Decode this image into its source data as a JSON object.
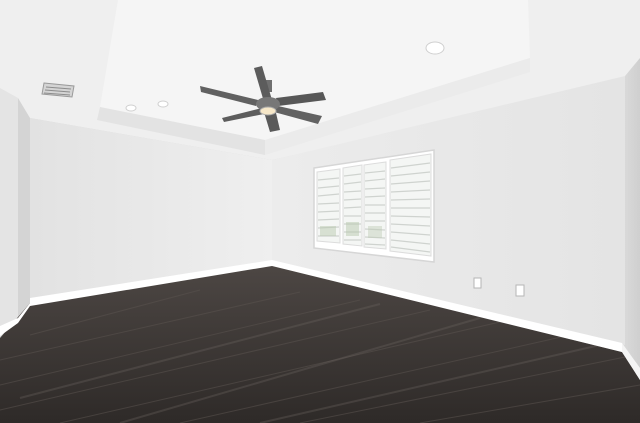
{
  "scene": {
    "description_free": true,
    "colors": {
      "ceiling": "#f1f1f1",
      "tray_ceiling": "#f6f6f6",
      "wall_left": "#e9e9e9",
      "wall_back_left": "#eeeeee",
      "wall_back_right": "#e7e7e7",
      "wall_right": "#dcdcdc",
      "floor_dark": "#2f2b29",
      "floor_mid": "#4a4542",
      "baseboard": "#ffffff",
      "shutter": "#f8f8f8",
      "fan_metal": "#6f6f6f"
    },
    "elements": [
      "ceiling-fan",
      "recessed-light",
      "hvac-vent",
      "plantation-shutter-window",
      "electrical-outlet",
      "baseboard",
      "wood-floor"
    ]
  }
}
